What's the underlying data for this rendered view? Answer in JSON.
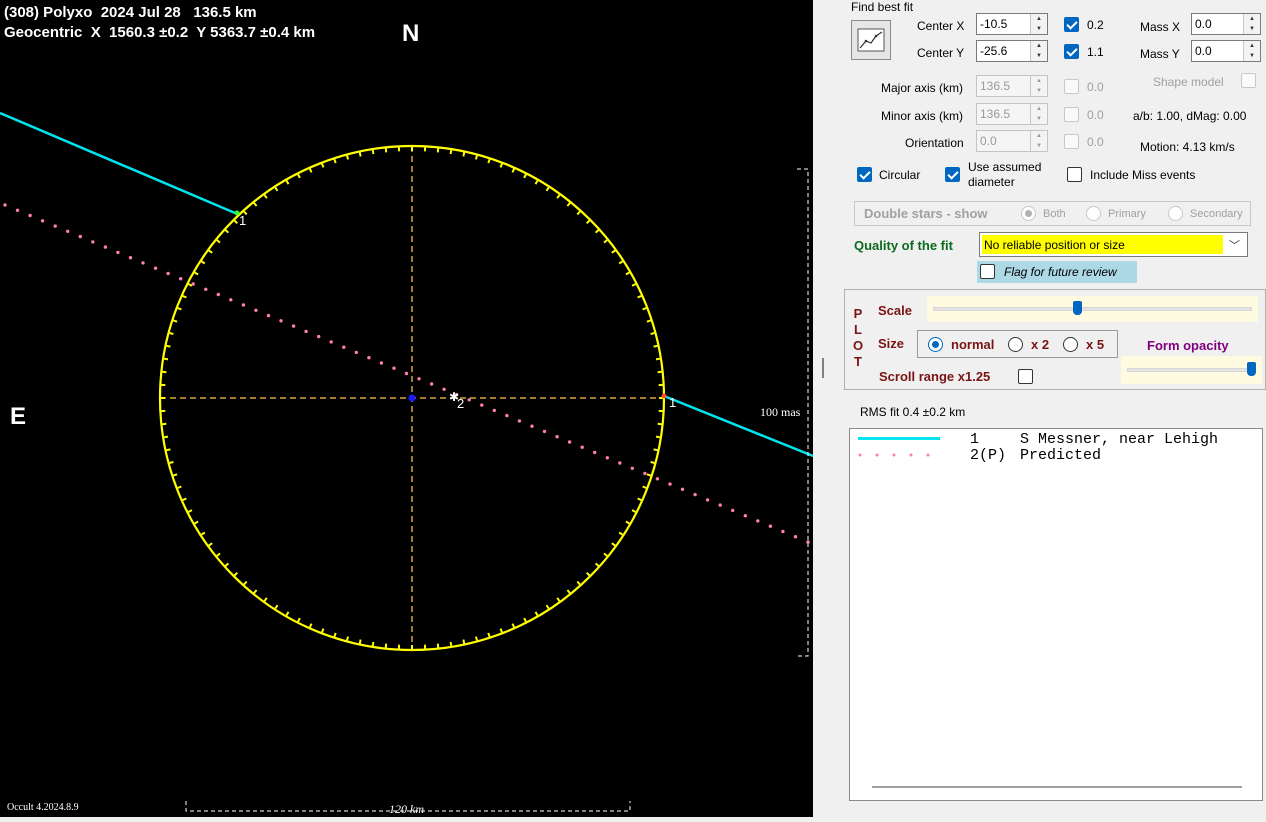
{
  "plot": {
    "title_line1": "(308) Polyxo  2024 Jul 28   136.5 km",
    "title_line2": "Geocentric  X  1560.3 ±0.2  Y 5363.7 ±0.4 km",
    "north": "N",
    "east": "E",
    "scale_mas_label": "100 mas",
    "scale_km_label": "120 km",
    "version": "Occult 4.2024.8.9",
    "chord_labels": [
      "1",
      "2",
      "1"
    ],
    "colors": {
      "background": "#000000",
      "ellipse": "#ffff00",
      "axes": "#d9a43b",
      "observed_chord": "#00e5ee",
      "predicted_chord": "#ff7eb0"
    }
  },
  "panel": {
    "find_best_fit": "Find best fit",
    "best_fit_button_icon": "chart-fit-icon",
    "center_x": {
      "label": "Center X",
      "value": "-10.5",
      "weight_value": "0.2",
      "checked": true
    },
    "center_y": {
      "label": "Center Y",
      "value": "-25.6",
      "weight_value": "1.1",
      "checked": true
    },
    "mass_x": {
      "label": "Mass X",
      "value": "0.0"
    },
    "mass_y": {
      "label": "Mass Y",
      "value": "0.0"
    },
    "major_axis": {
      "label": "Major axis (km)",
      "value": "136.5",
      "weight_value": "0.0"
    },
    "minor_axis": {
      "label": "Minor axis (km)",
      "value": "136.5",
      "weight_value": "0.0"
    },
    "orientation": {
      "label": "Orientation",
      "value": "0.0",
      "weight_value": "0.0"
    },
    "shape_model": "Shape model",
    "ab_dmag": "a/b: 1.00, dMag: 0.00",
    "motion": "Motion: 4.13 km/s",
    "circular": "Circular",
    "use_assumed_diameter": "Use assumed diameter",
    "include_miss": "Include Miss events",
    "double_stars": {
      "label": "Double stars - show",
      "both": "Both",
      "primary": "Primary",
      "secondary": "Secondary"
    },
    "quality_label": "Quality of the fit",
    "quality_value": "No reliable position or size",
    "flag_review": "Flag for future review",
    "plot_group": {
      "letters": [
        "P",
        "L",
        "O",
        "T"
      ],
      "scale": "Scale",
      "scale_level": 0.45,
      "size": "Size",
      "size_normal": "normal",
      "size_x2": "x 2",
      "size_x5": "x 5",
      "form_opacity": "Form opacity",
      "opacity_level": 1.0,
      "scroll_range": "Scroll range x1.25"
    },
    "rms_fit": "RMS fit 0.4 ±0.2 km",
    "legend": [
      {
        "num": "1",
        "name": "S Messner, near Lehigh",
        "style": "solid",
        "color": "#00e5ee"
      },
      {
        "num": "2(P)",
        "name": "Predicted",
        "style": "dotted",
        "color": "#ff7eb0"
      }
    ]
  }
}
